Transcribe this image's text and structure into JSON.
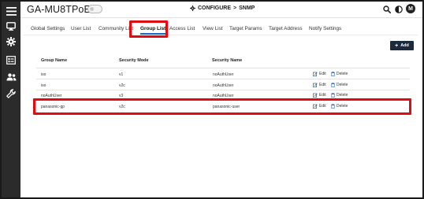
{
  "app": {
    "title": "GA-MU8TPoE+"
  },
  "breadcrumb": {
    "section": "CONFIGURE",
    "separator": ">",
    "page": "SNMP"
  },
  "header": {
    "avatar_initial": "M"
  },
  "tabs": [
    {
      "label": "Global Settings"
    },
    {
      "label": "User List"
    },
    {
      "label": "Community List"
    },
    {
      "label": "Group List"
    },
    {
      "label": "Access List"
    },
    {
      "label": "View List"
    },
    {
      "label": "Target Params"
    },
    {
      "label": "Target Address"
    },
    {
      "label": "Notify Settings"
    }
  ],
  "active_tab": "Group List",
  "add_button": {
    "label": "Add"
  },
  "table": {
    "columns": [
      "Group Name",
      "Security Mode",
      "Security Name"
    ],
    "rows": [
      {
        "group_name": "iso",
        "security_mode": "v1",
        "security_name": "noAuthUser",
        "edit": "Edit",
        "delete": "Delete"
      },
      {
        "group_name": "iso",
        "security_mode": "v2c",
        "security_name": "noAuthUser",
        "edit": "Edit",
        "delete": "Delete"
      },
      {
        "group_name": "noAuthUser",
        "security_mode": "v3",
        "security_name": "noAuthUser",
        "edit": "Edit",
        "delete": "Delete"
      },
      {
        "group_name": "panasonic-gp",
        "security_mode": "v2c",
        "security_name": "panasonic-user",
        "edit": "Edit",
        "delete": "Delete"
      }
    ]
  },
  "icons": {
    "sidebar": [
      "menu-icon",
      "monitor-icon",
      "gear-icon",
      "list-icon",
      "users-icon",
      "wrench-icon"
    ],
    "header": [
      "search-icon",
      "contrast-icon"
    ],
    "row_actions": [
      "edit-icon",
      "trash-icon"
    ]
  },
  "colors": {
    "sidebar": "#2b2b2b",
    "accent": "#1f66c9",
    "add_button": "#1b2a3d",
    "highlight": "#e20b14"
  }
}
